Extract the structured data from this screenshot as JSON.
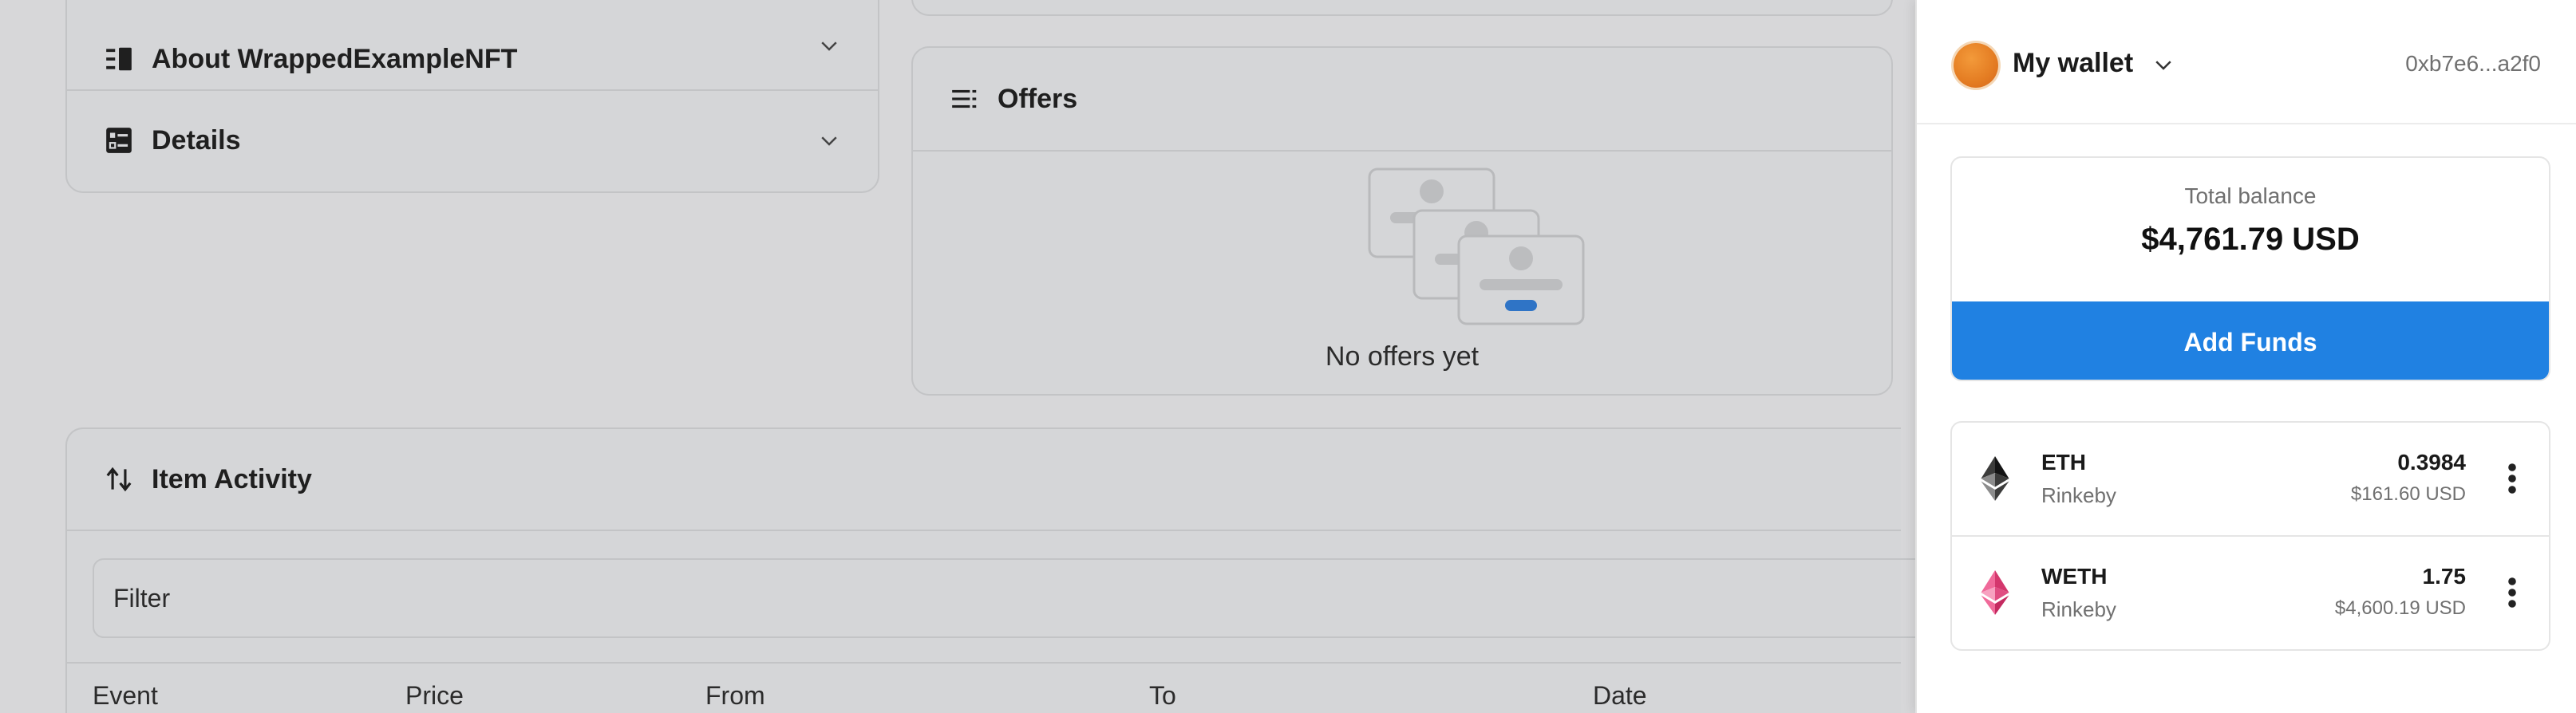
{
  "accordion": {
    "about_label": "About WrappedExampleNFT",
    "details_label": "Details"
  },
  "offers": {
    "title": "Offers",
    "empty_text": "No offers yet"
  },
  "activity": {
    "title": "Item Activity",
    "filter_placeholder": "Filter",
    "columns": [
      "Event",
      "Price",
      "From",
      "To",
      "Date"
    ]
  },
  "wallet": {
    "name": "My wallet",
    "address": "0xb7e6...a2f0",
    "balance_label": "Total balance",
    "balance_value": "$4,761.79 USD",
    "add_funds_label": "Add Funds",
    "tokens": [
      {
        "symbol": "ETH",
        "network": "Rinkeby",
        "amount": "0.3984",
        "usd": "$161.60 USD",
        "icon": "eth-icon"
      },
      {
        "symbol": "WETH",
        "network": "Rinkeby",
        "amount": "1.75",
        "usd": "$4,600.19 USD",
        "icon": "weth-icon"
      }
    ],
    "accent_color": "#2081e2"
  },
  "icons": {
    "about": "list-icon",
    "details": "details-icon",
    "offers": "offers-list-icon",
    "activity": "swap-vertical-icon",
    "chevron": "chevron-down-icon",
    "more": "more-vertical-icon"
  }
}
